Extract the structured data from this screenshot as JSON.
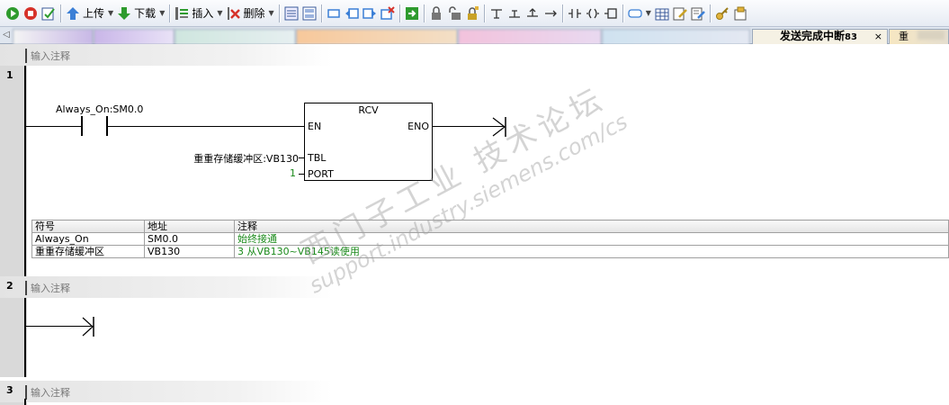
{
  "toolbar": {
    "upload_label": "上传",
    "download_label": "下载",
    "insert_label": "插入",
    "delete_label": "删除",
    "icons": [
      "run-icon",
      "stop-icon",
      "compile-check-icon",
      "upload-icon",
      "download-icon",
      "insert-icon",
      "delete-icon",
      "toggle-view-icon",
      "network-icon",
      "rect-icon",
      "jump-left-icon",
      "jump-right-icon",
      "clear-icon",
      "go-icon",
      "lock-icon",
      "unlock-icon",
      "lock-add-icon",
      "branch-down-icon",
      "branch-up-icon",
      "line-up-icon",
      "line-right-icon",
      "contact-icon",
      "coil-icon",
      "box-icon",
      "instruction-icon",
      "table-icon",
      "edit-icon",
      "edit2-icon",
      "key-icon",
      "note-icon"
    ]
  },
  "tabs": {
    "active_label": "发送完成中断",
    "active_suffix": "83",
    "close_glyph": "×",
    "next_label": "重",
    "scroll_left": "◁"
  },
  "networks": [
    {
      "number": "1",
      "comment": "输入注释"
    },
    {
      "number": "2",
      "comment": "输入注释"
    },
    {
      "number": "3",
      "comment": "输入注释"
    }
  ],
  "network1": {
    "contact_label": "Always_On:SM0.0",
    "box_title": "RCV",
    "pin_en": "EN",
    "pin_eno": "ENO",
    "pin_tbl": "TBL",
    "pin_port": "PORT",
    "tbl_operand": "重重存储缓冲区:VB130",
    "port_operand": "1"
  },
  "symbol_table": {
    "headers": [
      "符号",
      "地址",
      "注释"
    ],
    "rows": [
      [
        "Always_On",
        "SM0.0",
        "始终接通"
      ],
      [
        "重重存储缓冲区",
        "VB130",
        "3 从VB130~VB145读使用"
      ]
    ]
  },
  "watermark": {
    "cn": "西门子工业 技术论坛",
    "url": "support.industry.siemens.com/cs"
  },
  "colors": {
    "note_green": "#1b8a1b",
    "run_green": "#2e9b2e",
    "stop_red": "#d6322a"
  }
}
